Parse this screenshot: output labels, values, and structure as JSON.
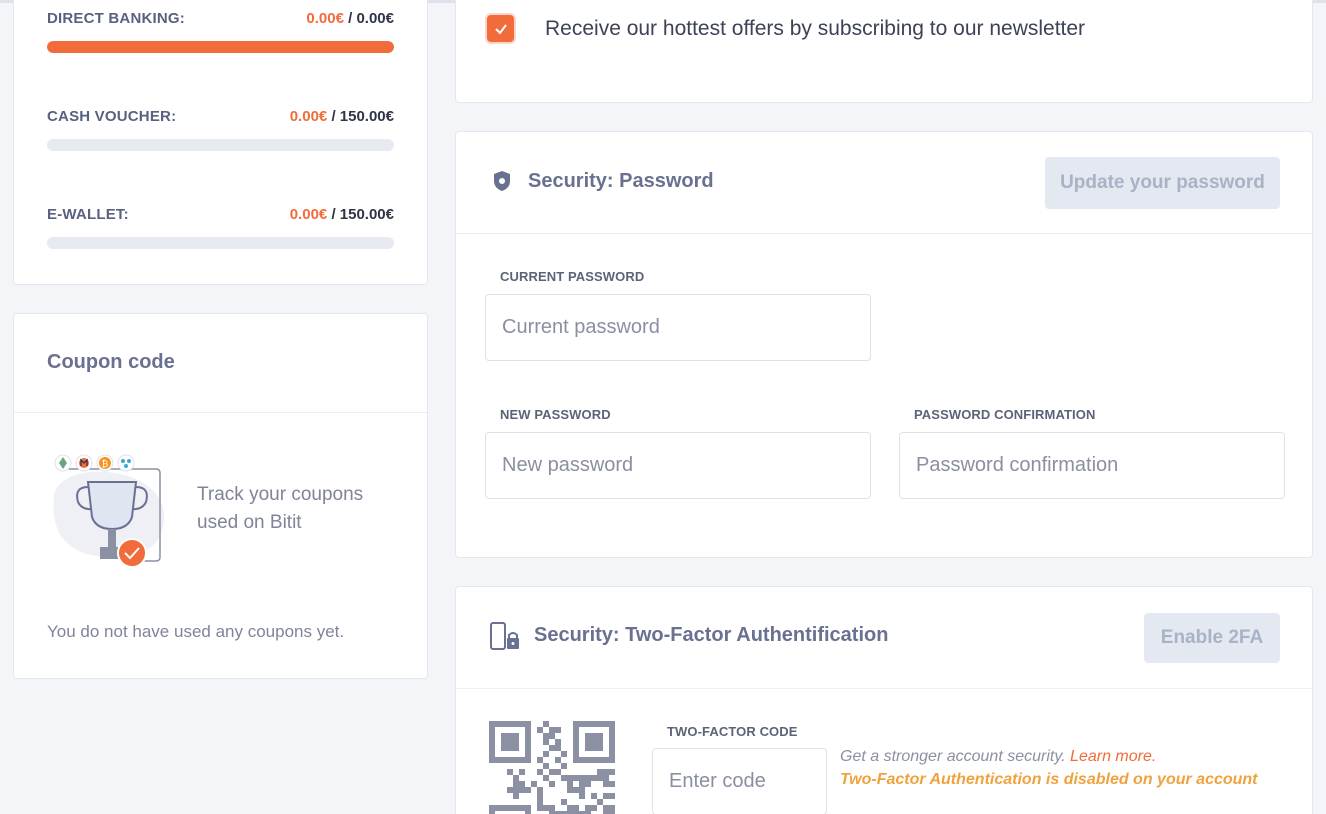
{
  "limits": [
    {
      "label": "DIRECT BANKING:",
      "used": "0.00€",
      "max": "/ 0.00€",
      "progress": 1.0
    },
    {
      "label": "CASH VOUCHER:",
      "used": "0.00€",
      "max": "/ 150.00€",
      "progress": 0.0
    },
    {
      "label": "E-WALLET:",
      "used": "0.00€",
      "max": "/ 150.00€",
      "progress": 0.0
    }
  ],
  "coupon": {
    "title": "Coupon code",
    "track_text": "Track your coupons used on Bitit",
    "empty_text": "You do not have used any coupons yet."
  },
  "newsletter": {
    "checked": true,
    "label": "Receive our hottest offers by subscribing to our newsletter"
  },
  "password": {
    "title": "Security: Password",
    "update_button": "Update your password",
    "current_label": "CURRENT PASSWORD",
    "current_placeholder": "Current password",
    "new_label": "NEW PASSWORD",
    "new_placeholder": "New password",
    "confirm_label": "PASSWORD CONFIRMATION",
    "confirm_placeholder": "Password confirmation"
  },
  "twofa": {
    "title": "Security: Two-Factor Authentification",
    "enable_button": "Enable 2FA",
    "code_label": "TWO-FACTOR CODE",
    "code_placeholder": "Enter code",
    "info_text": "Get a stronger account security.",
    "learn_more": "Learn more.",
    "disabled_text": "Two-Factor Authentication is disabled on your account"
  },
  "colors": {
    "accent": "#f26b3a",
    "warning": "#f0a23e",
    "disabled_button": "#e3e8f1"
  }
}
